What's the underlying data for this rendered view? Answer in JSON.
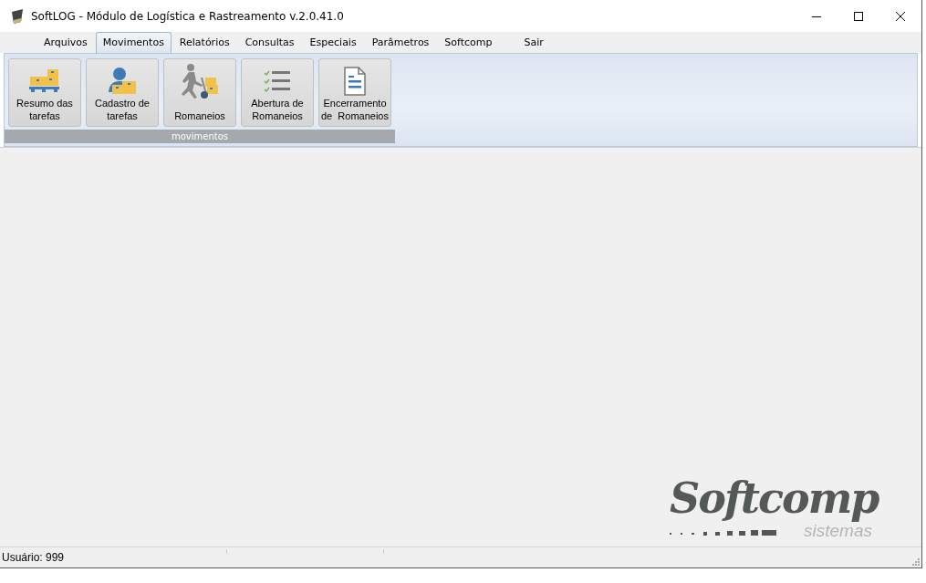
{
  "window": {
    "title": "SoftLOG - Módulo de Logística e Rastreamento v.2.0.41.0"
  },
  "menu": [
    {
      "label": "Arquivos",
      "selected": false
    },
    {
      "label": "Movimentos",
      "selected": true
    },
    {
      "label": "Relatórios",
      "selected": false
    },
    {
      "label": "Consultas",
      "selected": false
    },
    {
      "label": "Especiais",
      "selected": false
    },
    {
      "label": "Parâmetros",
      "selected": false
    },
    {
      "label": "Softcomp",
      "selected": false
    },
    {
      "label": "Sair",
      "selected": false
    }
  ],
  "ribbon": {
    "group": "movimentos",
    "buttons": [
      {
        "label": "Resumo das tarefas"
      },
      {
        "label": "Cadastro de tarefas"
      },
      {
        "label": "Romaneios"
      },
      {
        "label": "Abertura de Romaneios"
      },
      {
        "label": "Encerramento de  Romaneios"
      }
    ]
  },
  "logo": {
    "name": "Softcomp",
    "tagline": "sistemas"
  },
  "status_bar": {
    "user": "Usuário: 999"
  }
}
